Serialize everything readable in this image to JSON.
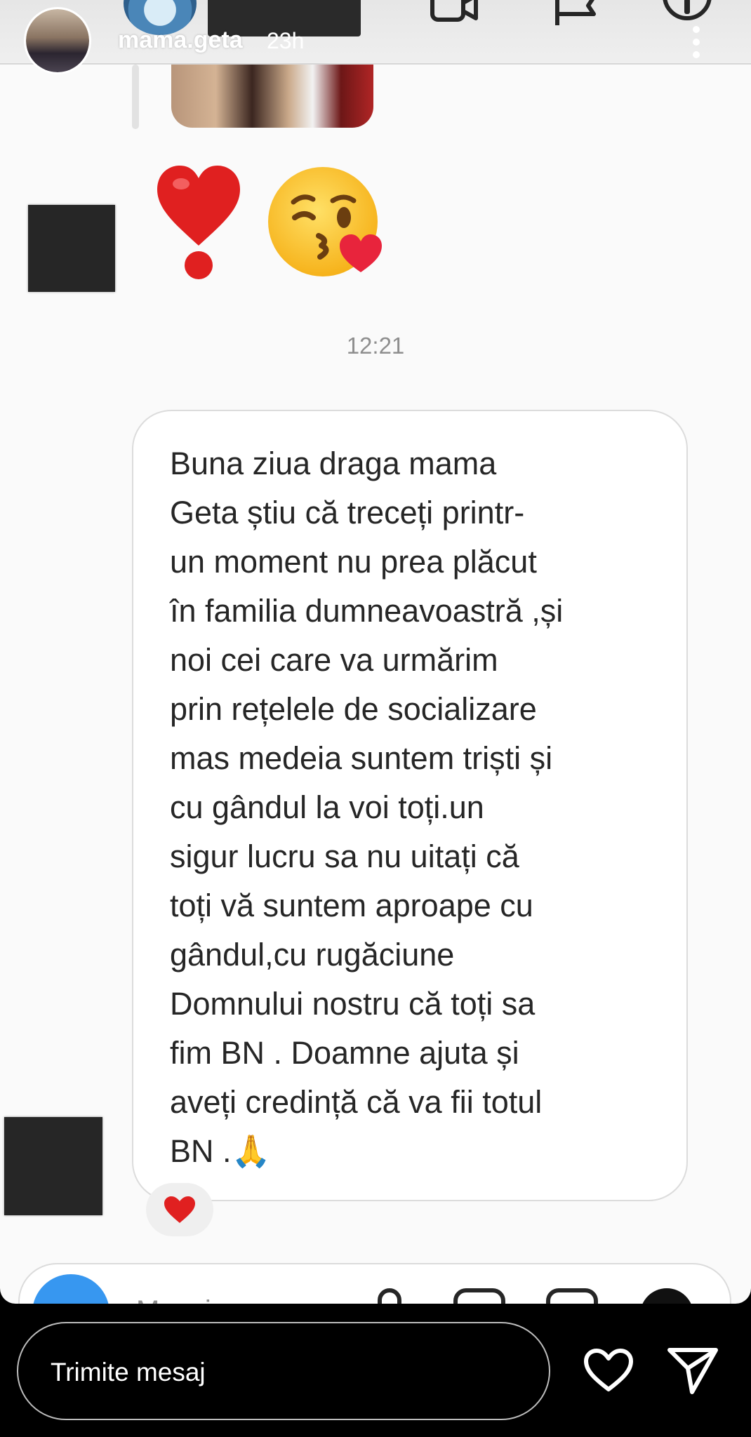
{
  "story": {
    "username": "mama.geta",
    "time_ago": "23h",
    "reply_placeholder": "Trimite mesaj"
  },
  "screenshot": {
    "emojis": [
      "❤️",
      "❗",
      "😘"
    ],
    "timestamp": "12:21",
    "message": "Buna ziua draga mama\nGeta știu că treceți printr-\nun moment nu prea plăcut\nîn familia dumneavoastră ,și\nnoi cei care va urmărim\nprin rețelele de socializare\nmas medeia suntem triști și\ncu gândul la voi toți.un\nsigur lucru sa nu uitați că\ntoți vă suntem aproape cu\ngândul,cu  rugăciune\nDomnului nostru că toți sa\nfim BN . Doamne ajuta și\naveți credință că va fii totul\nBN .🙏",
    "reaction": "❤️",
    "composer_placeholder": "Mesaj..."
  },
  "colors": {
    "accent": "#3797f0",
    "heart": "#e0245e",
    "bubble_border": "#dcdcdc",
    "timestamp": "#8e8e8e"
  }
}
